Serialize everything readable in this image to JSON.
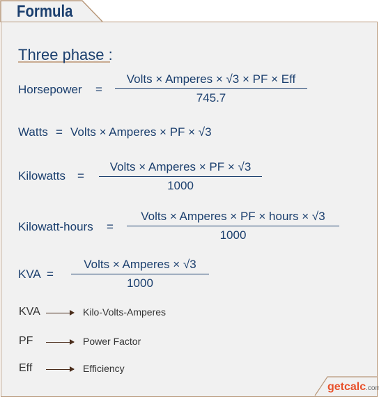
{
  "header": {
    "title": "Formula"
  },
  "section": "Three phase :",
  "formulas": [
    {
      "label": "Horsepower",
      "eq": "=",
      "numerator": "Volts × Amperes × √3 × PF × Eff",
      "denominator": "745.7"
    },
    {
      "label": "Watts",
      "eq": "=",
      "expression": "Volts × Amperes × PF × √3"
    },
    {
      "label": "Kilowatts",
      "eq": "=",
      "numerator": "Volts × Amperes × PF × √3",
      "denominator": "1000"
    },
    {
      "label": "Kilowatt-hours",
      "eq": "=",
      "numerator": "Volts × Amperes × PF × hours × √3",
      "denominator": "1000"
    },
    {
      "label": "KVA",
      "eq": "=",
      "numerator": "Volts × Amperes  × √3",
      "denominator": "1000"
    }
  ],
  "legend": [
    {
      "abbr": "KVA",
      "meaning": "Kilo-Volts-Amperes"
    },
    {
      "abbr": "PF",
      "meaning": "Power Factor"
    },
    {
      "abbr": "Eff",
      "meaning": "Efficiency"
    }
  ],
  "logo": {
    "text": "getcalc",
    "suffix": ".com"
  },
  "colors": {
    "text": "#1b3f6e",
    "border": "#b8987a",
    "arrow": "#4a2c1a",
    "background": "#f1f1f1"
  }
}
